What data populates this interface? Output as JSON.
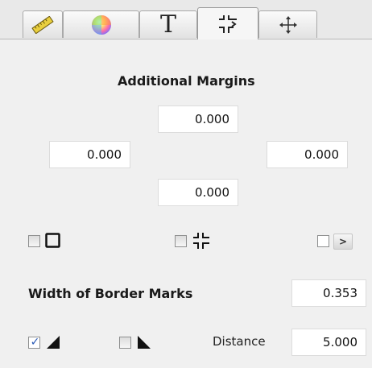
{
  "tabs": [
    {
      "icon": "ruler-icon",
      "active": false
    },
    {
      "icon": "color-wheel-icon",
      "active": false
    },
    {
      "icon": "text-icon",
      "label": "T",
      "active": false
    },
    {
      "icon": "crop-marks-icon",
      "active": true
    },
    {
      "icon": "move-arrows-icon",
      "active": false
    }
  ],
  "margins": {
    "title": "Additional Margins",
    "top": "0.000",
    "left": "0.000",
    "right": "0.000",
    "bottom": "0.000"
  },
  "border_options": {
    "frame_checked": false,
    "crop_marks_checked": false,
    "more_checked": false,
    "more_button": ">"
  },
  "border_marks": {
    "label": "Width of Border Marks",
    "value": "0.353"
  },
  "corner": {
    "left_corner_checked": true,
    "right_corner_checked": false,
    "distance_label": "Distance",
    "distance_value": "5.000"
  }
}
